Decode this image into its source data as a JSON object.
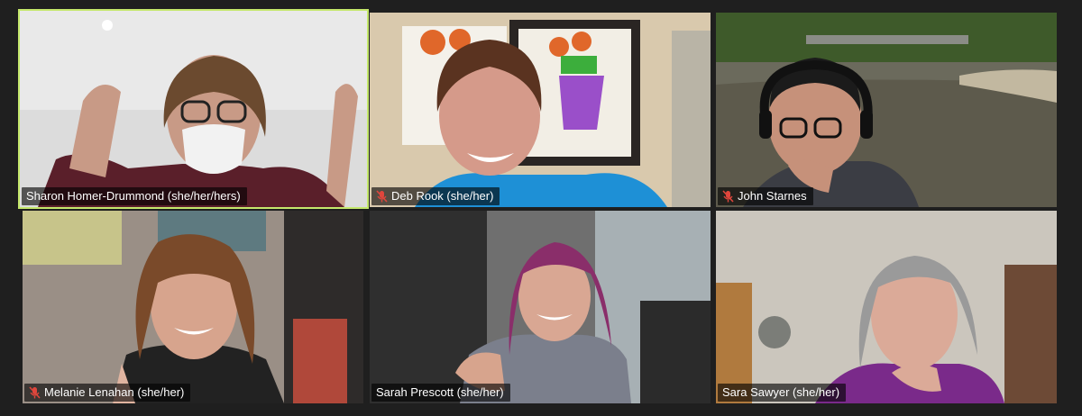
{
  "colors": {
    "background": "#1f1f1f",
    "active_speaker_border": "#c5e86c",
    "muted_icon": "#e0463c",
    "nameplate_bg": "rgba(0,0,0,0.62)"
  },
  "participants": [
    {
      "name": "Sharon Homer-Drummond (she/her/hers)",
      "muted": false,
      "active_speaker": true
    },
    {
      "name": "Deb Rook (she/her)",
      "muted": true,
      "active_speaker": false
    },
    {
      "name": "John Starnes",
      "muted": true,
      "active_speaker": false
    },
    {
      "name": "Melanie Lenahan (she/her)",
      "muted": true,
      "active_speaker": false
    },
    {
      "name": "Sarah Prescott (she/her)",
      "muted": false,
      "active_speaker": false
    },
    {
      "name": "Sara Sawyer (she/her)",
      "muted": false,
      "active_speaker": false
    }
  ],
  "icons": {
    "muted": "microphone-muted-icon"
  }
}
